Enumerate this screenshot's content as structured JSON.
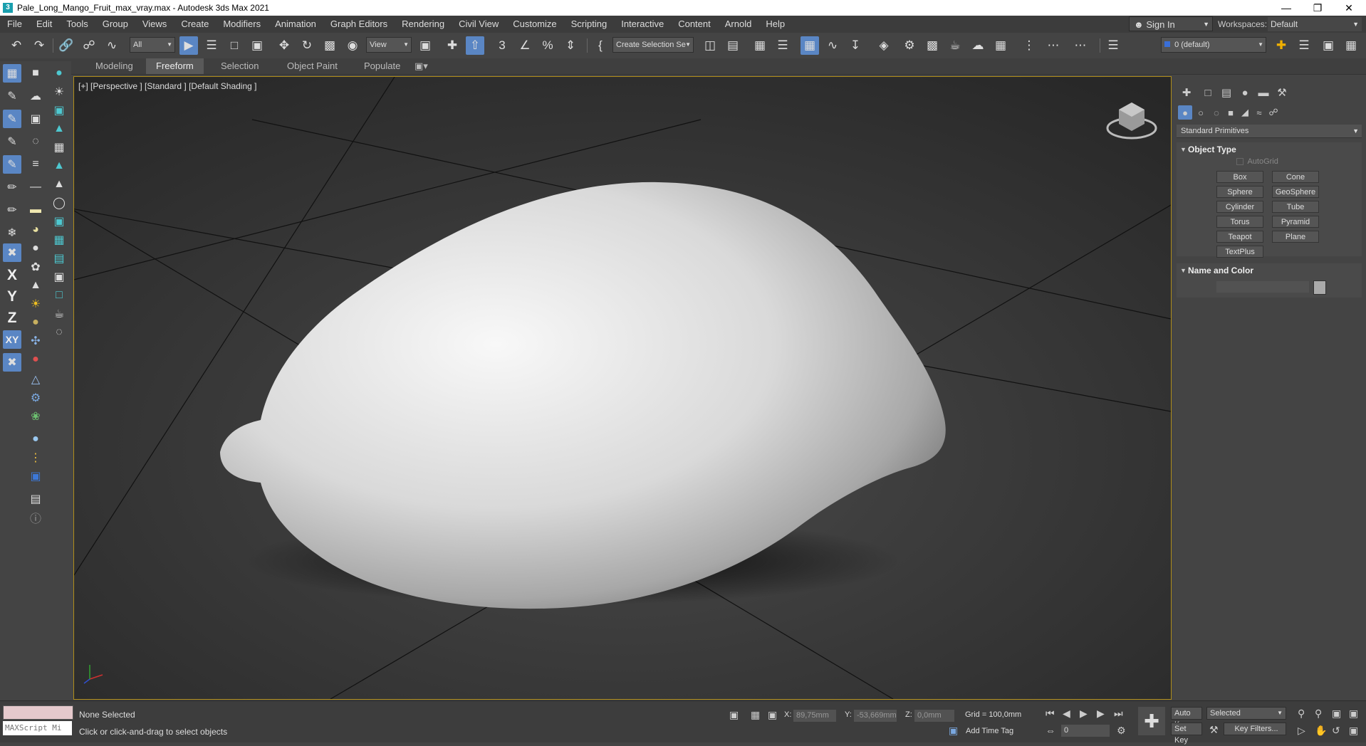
{
  "window": {
    "title": "Pale_Long_Mango_Fruit_max_vray.max - Autodesk 3ds Max 2021",
    "app_icon": "3"
  },
  "menu": [
    "File",
    "Edit",
    "Tools",
    "Group",
    "Views",
    "Create",
    "Modifiers",
    "Animation",
    "Graph Editors",
    "Rendering",
    "Civil View",
    "Customize",
    "Scripting",
    "Interactive",
    "Content",
    "Arnold",
    "Help"
  ],
  "account": {
    "signin": "Sign In",
    "workspaces_label": "Workspaces:",
    "workspace": "Default"
  },
  "toolbar": {
    "filter": "All",
    "refcoord": "View",
    "selection_set": "Create Selection Se",
    "layer": "0 (default)",
    "snaps_label": "3",
    "percent_label": "%"
  },
  "ribbon": [
    "Modeling",
    "Freeform",
    "Selection",
    "Object Paint",
    "Populate"
  ],
  "left_axes": [
    "X",
    "Y",
    "Z",
    "XY"
  ],
  "viewport": {
    "label": "[+] [Perspective ] [Standard ] [Default Shading ]"
  },
  "command_panel": {
    "category": "Standard Primitives",
    "object_type": {
      "title": "Object Type",
      "autogrid": "AutoGrid",
      "buttons": [
        "Box",
        "Cone",
        "Sphere",
        "GeoSphere",
        "Cylinder",
        "Tube",
        "Torus",
        "Pyramid",
        "Teapot",
        "Plane",
        "TextPlus"
      ]
    },
    "name_color": {
      "title": "Name and Color"
    }
  },
  "status": {
    "maxscript": "MAXScript Mi",
    "selection": "None Selected",
    "prompt": "Click or click-and-drag to select objects",
    "x_label": "X:",
    "x_value": "89,75mm",
    "y_label": "Y:",
    "y_value": "-53,669mm",
    "z_label": "Z:",
    "z_value": "0,0mm",
    "grid": "Grid = 100,0mm",
    "add_time_tag": "Add Time Tag",
    "frame": "0",
    "auto_key": "Auto K..",
    "set_key": "Set Key",
    "key_mode": "Selected",
    "key_filters": "Key Filters..."
  }
}
